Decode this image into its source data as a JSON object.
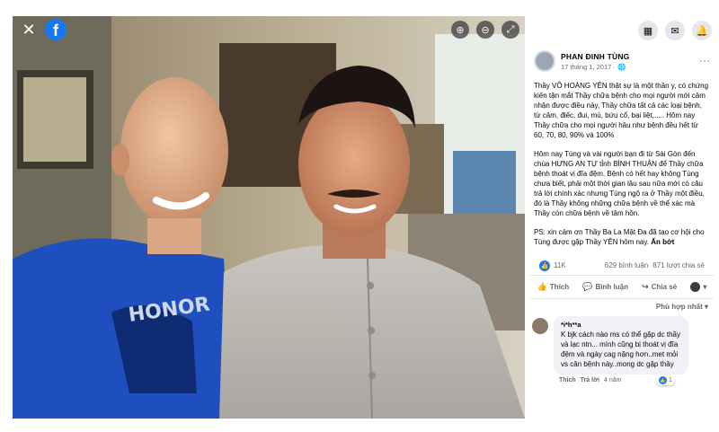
{
  "viewer": {
    "close_glyph": "✕",
    "fb_glyph": "f",
    "controls": [
      {
        "name": "zoom-in-icon",
        "glyph": "⊕"
      },
      {
        "name": "zoom-out-icon",
        "glyph": "⊖"
      },
      {
        "name": "fullscreen-icon",
        "glyph": "⤢"
      }
    ]
  },
  "top_actions": [
    {
      "name": "menu-grid-icon",
      "glyph": "▦"
    },
    {
      "name": "messenger-icon",
      "glyph": "✉"
    },
    {
      "name": "notifications-icon",
      "glyph": "🔔"
    }
  ],
  "post": {
    "author": "PHAN ĐINH TÙNG",
    "date": "17 tháng 1, 2017 · ",
    "privacy_glyph": "🌐",
    "more_glyph": "···",
    "paragraph_1": "Thầy VÕ HOÀNG YÊN thật sự là một thần y, có chứng kiến tận mắt Thầy chữa bệnh cho mọi người mới cảm nhận được điều này, Thầy chữa tất cả các loại bệnh, từ câm, điếc, đui, mù, bứu cổ, bại liệt,..... Hôm nay Thầy chữa cho mọi người hầu như bệnh đều hết từ 60, 70, 80, 90% và 100%",
    "paragraph_2": "Hôm nay Tùng và vài người bạn đi từ Sài Gòn đến chùa HƯNG AN TỰ tỉnh BÌNH THUẬN để Thầy chữa bệnh thoát vị đĩa đệm. Bệnh có hết hay không Tùng chưa biết, phải một thời gian lâu sau nữa mới có câu trả lời chính xác nhưng Tùng ngộ ra ở Thầy một điều, đó là Thầy không những chữa bệnh về thể xác mà Thầy còn chữa bệnh về tâm hồn.",
    "paragraph_3": "PS: xin cảm ơn Thầy Ba La Mật Đa đã tạo cơ hội cho Tùng được gặp Thầy YÊN hôm nay. ",
    "see_more": "Ẩn bớt"
  },
  "stats": {
    "like_glyph": "👍",
    "reactions": "11K",
    "comments": "629 bình luận",
    "shares": "871 lượt chia sẻ"
  },
  "actions": {
    "like_glyph": "👍",
    "like": "Thích",
    "comment_glyph": "💬",
    "comment": "Bình luận",
    "share_glyph": "↪",
    "share": "Chia sẻ",
    "audience_caret": "▾"
  },
  "sort_label": "Phù hợp nhất ▾",
  "comment": {
    "author": "*i*h**a",
    "text": "K bjk cách nào ms có thể gặp dc thầy và lạc ntn... mình cũng bị thoát vị đĩa đệm và ngày cag nặng hơn..met mỏi vs căn bệnh này..mong dc gặp thầy",
    "like_glyph": "👍",
    "reaction_count": "1",
    "like_label": "Thích",
    "reply_label": "Trả lời",
    "time": "4 năm"
  }
}
